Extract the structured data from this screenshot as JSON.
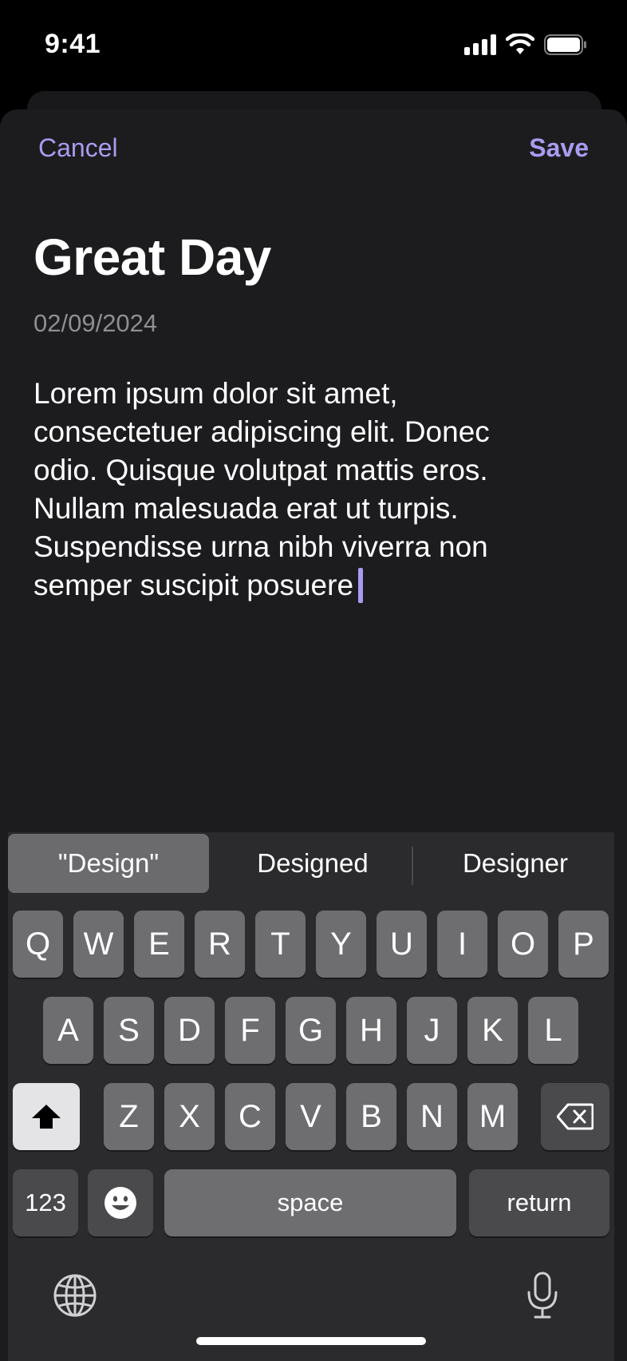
{
  "status": {
    "time": "9:41"
  },
  "nav": {
    "cancel": "Cancel",
    "save": "Save"
  },
  "entry": {
    "title": "Great Day",
    "date": "02/09/2024",
    "body_lines": [
      "Lorem ipsum dolor sit amet,",
      "consectetuer adipiscing elit. Donec",
      "odio. Quisque volutpat mattis eros.",
      "Nullam malesuada erat ut turpis.",
      "Suspendisse urna nibh viverra non",
      "semper suscipit posuere"
    ]
  },
  "keyboard": {
    "suggestions": [
      "\"Design\"",
      "Designed",
      "Designer"
    ],
    "row1": [
      "Q",
      "W",
      "E",
      "R",
      "T",
      "Y",
      "U",
      "I",
      "O",
      "P"
    ],
    "row2": [
      "A",
      "S",
      "D",
      "F",
      "G",
      "H",
      "J",
      "K",
      "L"
    ],
    "row3": [
      "Z",
      "X",
      "C",
      "V",
      "B",
      "N",
      "M"
    ],
    "numbers_key": "123",
    "space_key": "space",
    "return_key": "return"
  },
  "colors": {
    "accent": "#a89cf0",
    "background": "#1c1c1e",
    "date": "#8e8e93"
  },
  "icons": [
    "signal-icon",
    "wifi-icon",
    "battery-icon",
    "shift-icon",
    "backspace-icon",
    "emoji-icon",
    "globe-icon",
    "microphone-icon"
  ]
}
